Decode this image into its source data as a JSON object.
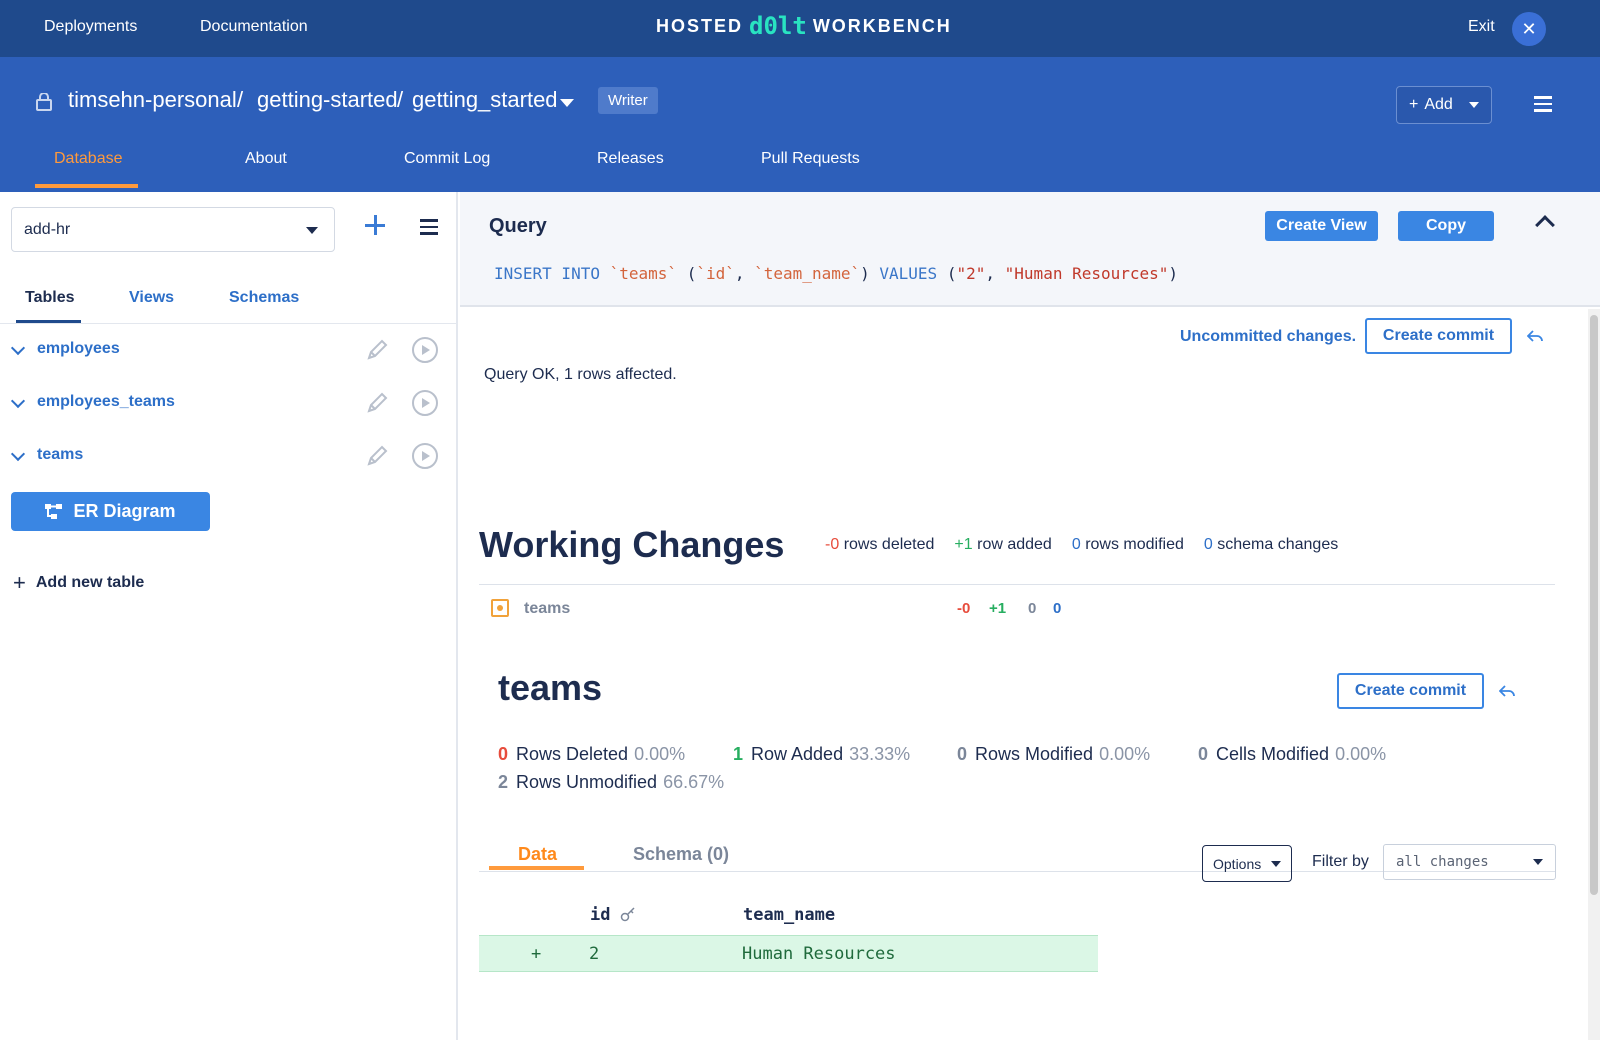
{
  "topbar": {
    "links": [
      "Deployments",
      "Documentation"
    ],
    "brand_left": "HOSTED",
    "brand_mid": "d0lt",
    "brand_right": "WORKBENCH",
    "exit_label": "Exit",
    "exit_icon": "close-icon"
  },
  "header": {
    "owner": "timsehn-personal",
    "deployment": "getting-started",
    "database": "getting_started",
    "sep": "/",
    "role_badge": "Writer",
    "add_label": "Add",
    "tabs": [
      {
        "label": "Database",
        "active": true
      },
      {
        "label": "About"
      },
      {
        "label": "Commit Log"
      },
      {
        "label": "Releases"
      },
      {
        "label": "Pull Requests"
      }
    ]
  },
  "sidebar": {
    "branch": "add-hr",
    "tabs": [
      "Tables",
      "Views",
      "Schemas"
    ],
    "tables": [
      "employees",
      "employees_teams",
      "teams"
    ],
    "er_diagram_label": "ER Diagram",
    "add_table_label": "Add new table"
  },
  "query": {
    "title": "Query",
    "create_view_label": "Create View",
    "copy_label": "Copy",
    "sql": {
      "kw1": "INSERT INTO",
      "table": "`teams`",
      "open": "(",
      "col1": "`id`",
      "comma": ",",
      "col2": "`team_name`",
      "close": ")",
      "kw2": "VALUES",
      "v_open": "(",
      "val1": "\"2\"",
      "val2": "\"Human Resources\"",
      "v_close": ")"
    }
  },
  "results": {
    "uncommitted": "Uncommitted changes.",
    "create_commit_label": "Create commit",
    "status": "Query OK, 1 rows affected."
  },
  "working_changes": {
    "title": "Working Changes",
    "deleted_num": "-0",
    "deleted_label": "rows deleted",
    "added_num": "+1",
    "added_label": "row added",
    "modified_num": "0",
    "modified_label": "rows modified",
    "schema_num": "0",
    "schema_label": "schema changes",
    "row": {
      "table": "teams",
      "deleted": "-0",
      "added": "+1",
      "modified": "0",
      "schema": "0"
    }
  },
  "table_diff": {
    "title": "teams",
    "create_commit_label": "Create commit",
    "stats": [
      {
        "num": "0",
        "label": "Rows Deleted",
        "pct": "0.00%"
      },
      {
        "num": "1",
        "label": "Row Added",
        "pct": "33.33%"
      },
      {
        "num": "0",
        "label": "Rows Modified",
        "pct": "0.00%"
      },
      {
        "num": "0",
        "label": "Cells Modified",
        "pct": "0.00%"
      },
      {
        "num": "2",
        "label": "Rows Unmodified",
        "pct": "66.67%"
      }
    ],
    "tabs": [
      "Data",
      "Schema (0)"
    ],
    "options_label": "Options",
    "filter_label": "Filter by",
    "filter_value": "all changes",
    "columns": [
      "id",
      "team_name"
    ],
    "rows": [
      {
        "marker": "+",
        "id": "2",
        "team_name": "Human Resources"
      }
    ]
  },
  "colors": {
    "navy": "#1f4a8c",
    "blue": "#2d5fba",
    "accent": "#ff9a3c",
    "added": "#dbf7e6"
  }
}
